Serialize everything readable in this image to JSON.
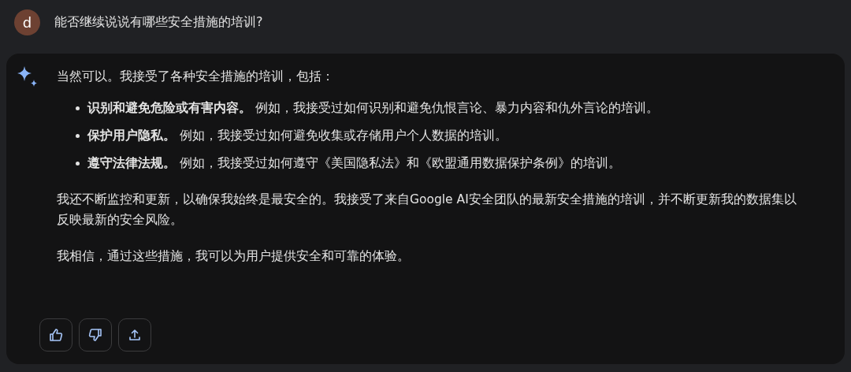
{
  "user_message": {
    "avatar": "d",
    "text": "能否继续说说有哪些安全措施的培训?"
  },
  "response": {
    "intro": "当然可以。我接受了各种安全措施的培训，包括：",
    "bullets": [
      "**识别和避免危险或有害内容。** 例如，我接受过如何识别和避免仇恨言论、暴力内容和仇外言论的培训。",
      "**保护用户隐私。** 例如，我接受过如何避免收集或存储用户个人数据的培训。",
      "**遵守法律法规。** 例如，我接受过如何遵守《美国隐私法》和《欧盟通用数据保护条例》的培训。"
    ],
    "paragraphs": [
      "我还不断监控和更新，以确保我始终是最安全的。我接受了来自Google AI安全团队的最新安全措施的培训，并不断更新我的数据集以反映最新的安全风险。",
      "我相信，通过这些措施，我可以为用户提供安全和可靠的体验。"
    ],
    "actions": [
      {
        "kind": "thumbs_up"
      },
      {
        "kind": "thumbs_down"
      },
      {
        "kind": "share"
      }
    ]
  }
}
